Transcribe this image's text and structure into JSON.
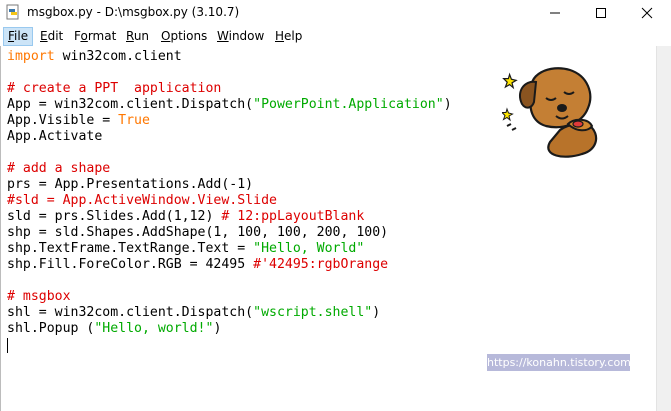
{
  "window": {
    "title": "msgbox.py - D:\\msgbox.py (3.10.7)",
    "app_icon": "python-file-icon",
    "controls": [
      "minimize-icon",
      "maximize-icon",
      "close-icon"
    ]
  },
  "menu": {
    "file": {
      "key": "F",
      "rest": "ile"
    },
    "edit": {
      "key": "E",
      "rest": "dit"
    },
    "format": {
      "key": "o",
      "pre": "F",
      "rest": "rmat"
    },
    "run": {
      "key": "R",
      "rest": "un"
    },
    "options": {
      "key": "O",
      "rest": "ptions"
    },
    "window": {
      "key": "W",
      "rest": "indow"
    },
    "help": {
      "key": "H",
      "rest": "elp"
    }
  },
  "code": {
    "l1_kw": "import",
    "l1_rest": " win32com.client",
    "l3": "# create a PPT  application",
    "l4_a": "App = win32com.client.Dispatch(",
    "l4_s": "\"PowerPoint.Application\"",
    "l4_b": ")",
    "l5_a": "App.Visible = ",
    "l5_kw": "True",
    "l6": "App.Activate",
    "l8": "# add a shape",
    "l9": "prs = App.Presentations.Add(-1)",
    "l10": "#sld = App.ActiveWindow.View.Slide",
    "l11_a": "sld = prs.Slides.Add(1,12) ",
    "l11_c": "# 12:ppLayoutBlank",
    "l12": "shp = sld.Shapes.AddShape(1, 100, 100, 200, 100)",
    "l13_a": "shp.TextFrame.TextRange.Text = ",
    "l13_s": "\"Hello, World\"",
    "l14_a": "shp.Fill.ForeColor.RGB = 42495 ",
    "l14_c": "#'42495:rgbOrange",
    "l16": "# msgbox",
    "l17_a": "shl = win32com.client.Dispatch(",
    "l17_s": "\"wscript.shell\"",
    "l17_b": ")",
    "l18_a": "shl.Popup (",
    "l18_s": "\"Hello, world!\"",
    "l18_b": ")"
  },
  "watermark": "https://konahn.tistory.com",
  "colors": {
    "keyword": "#ff7700",
    "string": "#00aa00",
    "comment": "#dd0000",
    "menu_active_bg": "#cce4f7",
    "watermark_bg": "#b7b9da"
  }
}
